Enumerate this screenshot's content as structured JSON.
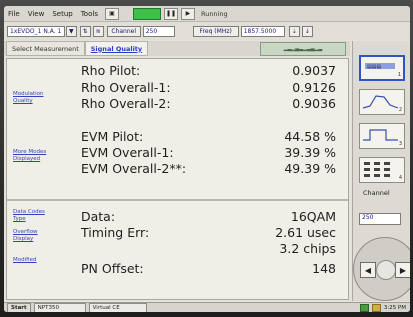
{
  "menu": {
    "items": [
      "File",
      "View",
      "Setup",
      "Tools"
    ],
    "run_status": "Running"
  },
  "controls": {
    "standard_value": "1xEVDO_1 N.A. 1",
    "channel_label": "Channel",
    "channel_value": "250",
    "freq_label": "Freq (MHz)",
    "freq_value": "1857.5000"
  },
  "tabs": {
    "select_measurement": "Select Measurement",
    "signal_quality": "Signal Quality"
  },
  "side_links": {
    "modulation_quality": "Modulation Quality",
    "more_modes": "More Modes Displayed",
    "data_codes": "Data Codes Type",
    "overflow_display": "Overflow Display",
    "modified": "Modified"
  },
  "metrics": [
    {
      "label": "Rho Pilot:",
      "value": "0.9037"
    },
    {
      "label": "Rho Overall-1:",
      "value": "0.9126"
    },
    {
      "label": "Rho Overall-2:",
      "value": "0.9036"
    },
    {
      "label": "EVM Pilot:",
      "value": "44.58 %"
    },
    {
      "label": "EVM Overall-1:",
      "value": "39.39 %"
    },
    {
      "label": "EVM Overall-2**:",
      "value": "49.39 %"
    }
  ],
  "data_section": {
    "data_label": "Data:",
    "data_value": "16QAM",
    "timing_label": "Timing Err:",
    "timing_value_1": "2.61 usec",
    "timing_value_2": "3.2 chips",
    "pn_label": "PN Offset:",
    "pn_value": "148"
  },
  "right_panel": {
    "thumb_numbers": [
      "1",
      "2",
      "3",
      "4"
    ],
    "channel_label": "Channel",
    "channel_value": "250"
  },
  "taskbar": {
    "start": "Start",
    "task1": "NPT350",
    "task2": "Virtual CE",
    "time": "3:25 PM"
  }
}
